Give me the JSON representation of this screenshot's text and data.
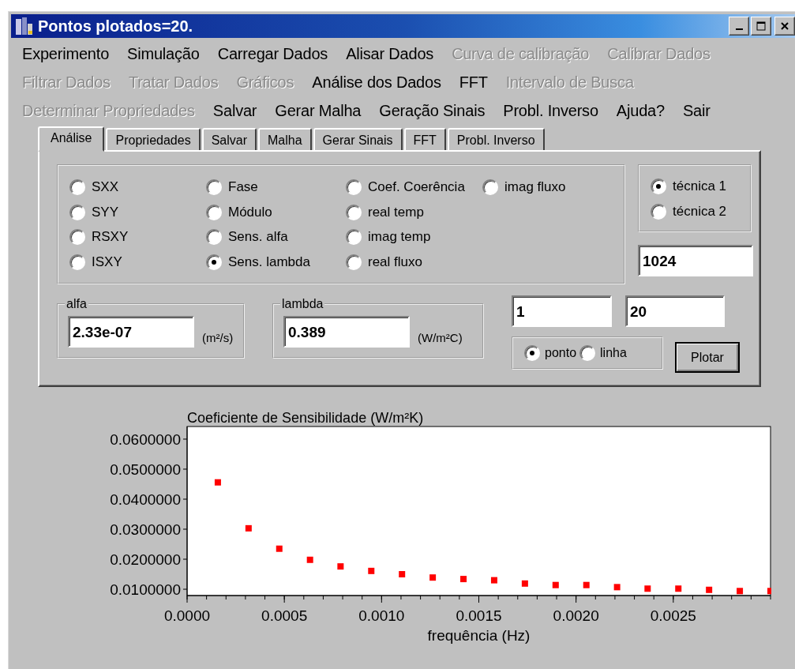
{
  "window": {
    "title": "Pontos plotados=20."
  },
  "menu_rows": [
    [
      {
        "label": "Experimento",
        "disabled": false
      },
      {
        "label": "Simulação",
        "disabled": false
      },
      {
        "label": "Carregar Dados",
        "disabled": false
      },
      {
        "label": "Alisar Dados",
        "disabled": false
      },
      {
        "label": "Curva de calibração",
        "disabled": true
      },
      {
        "label": "Calibrar Dados",
        "disabled": true
      }
    ],
    [
      {
        "label": "Filtrar Dados",
        "disabled": true
      },
      {
        "label": "Tratar Dados",
        "disabled": true
      },
      {
        "label": "Gráficos",
        "disabled": true
      },
      {
        "label": "Análise dos Dados",
        "disabled": false
      },
      {
        "label": "FFT",
        "disabled": false
      },
      {
        "label": "Intervalo de Busca",
        "disabled": true
      }
    ],
    [
      {
        "label": "Determinar Propriedades",
        "disabled": true
      },
      {
        "label": "Salvar",
        "disabled": false
      },
      {
        "label": "Gerar Malha",
        "disabled": false
      },
      {
        "label": "Geração Sinais",
        "disabled": false
      },
      {
        "label": "Probl. Inverso",
        "disabled": false
      },
      {
        "label": "Ajuda?",
        "disabled": false
      },
      {
        "label": "Sair",
        "disabled": false
      }
    ]
  ],
  "tabs": [
    {
      "label": "Análise",
      "selected": true
    },
    {
      "label": "Propriedades",
      "selected": false
    },
    {
      "label": "Salvar",
      "selected": false
    },
    {
      "label": "Malha",
      "selected": false
    },
    {
      "label": "Gerar Sinais",
      "selected": false
    },
    {
      "label": "FFT",
      "selected": false
    },
    {
      "label": "Probl. Inverso",
      "selected": false
    }
  ],
  "analysis": {
    "columns": [
      [
        {
          "label": "SXX",
          "selected": false
        },
        {
          "label": "SYY",
          "selected": false
        },
        {
          "label": "RSXY",
          "selected": false
        },
        {
          "label": "ISXY",
          "selected": false
        }
      ],
      [
        {
          "label": "Fase",
          "selected": false
        },
        {
          "label": "Módulo",
          "selected": false
        },
        {
          "label": "Sens. alfa",
          "selected": false
        },
        {
          "label": "Sens. lambda",
          "selected": true
        }
      ],
      [
        {
          "label": "Coef. Coerência",
          "selected": false
        },
        {
          "label": "real temp",
          "selected": false
        },
        {
          "label": "imag temp",
          "selected": false
        },
        {
          "label": "real fluxo",
          "selected": false
        }
      ],
      [
        {
          "label": "imag fluxo",
          "selected": false
        }
      ]
    ],
    "technique": [
      {
        "label": "técnica 1",
        "selected": true
      },
      {
        "label": "técnica 2",
        "selected": false
      }
    ],
    "points_field": {
      "value": "1024"
    },
    "alfa": {
      "label": "alfa",
      "value": "2.33e-07",
      "unit": "(m²/s)"
    },
    "lambda": {
      "label": "lambda",
      "value": "0.389",
      "unit": "(W/m²C)"
    },
    "range_from": {
      "value": "1"
    },
    "range_to": {
      "value": "20"
    },
    "plot_style": [
      {
        "label": "ponto",
        "selected": true
      },
      {
        "label": "linha",
        "selected": false
      }
    ],
    "plot_button": "Plotar"
  },
  "chart": {
    "chart_data": {
      "type": "scatter",
      "title": "Coeficiente de Sensibilidade (W/m²K)",
      "xlabel": "frequência (Hz)",
      "x": [
        0.000158,
        0.000316,
        0.000474,
        0.000632,
        0.000789,
        0.000947,
        0.001105,
        0.001263,
        0.001421,
        0.001579,
        0.001737,
        0.001895,
        0.002053,
        0.002211,
        0.002368,
        0.002526,
        0.002684,
        0.002842,
        0.003
      ],
      "series": [
        {
          "color": "#ff0000",
          "values": [
            0.0456,
            0.0303,
            0.0235,
            0.0198,
            0.0176,
            0.0161,
            0.015,
            0.0139,
            0.0134,
            0.013,
            0.0119,
            0.0114,
            0.0114,
            0.0107,
            0.0102,
            0.0102,
            0.0098,
            0.0094,
            0.0094
          ]
        }
      ],
      "xlim": [
        0,
        0.003
      ],
      "ylim": [
        0.0079,
        0.0642
      ],
      "xticks": [
        {
          "value": 0,
          "label": "0.0000"
        },
        {
          "value": 0.0005,
          "label": "0.0005"
        },
        {
          "value": 0.001,
          "label": "0.0010"
        },
        {
          "value": 0.0015,
          "label": "0.0015"
        },
        {
          "value": 0.002,
          "label": "0.0020"
        },
        {
          "value": 0.0025,
          "label": "0.0025"
        }
      ],
      "yticks": [
        {
          "value": 0.06,
          "label": "0.0600000"
        },
        {
          "value": 0.05,
          "label": "0.0500000"
        },
        {
          "value": 0.04,
          "label": "0.0400000"
        },
        {
          "value": 0.03,
          "label": "0.0300000"
        },
        {
          "value": 0.02,
          "label": "0.0200000"
        },
        {
          "value": 0.01,
          "label": "0.0100000"
        }
      ]
    }
  }
}
